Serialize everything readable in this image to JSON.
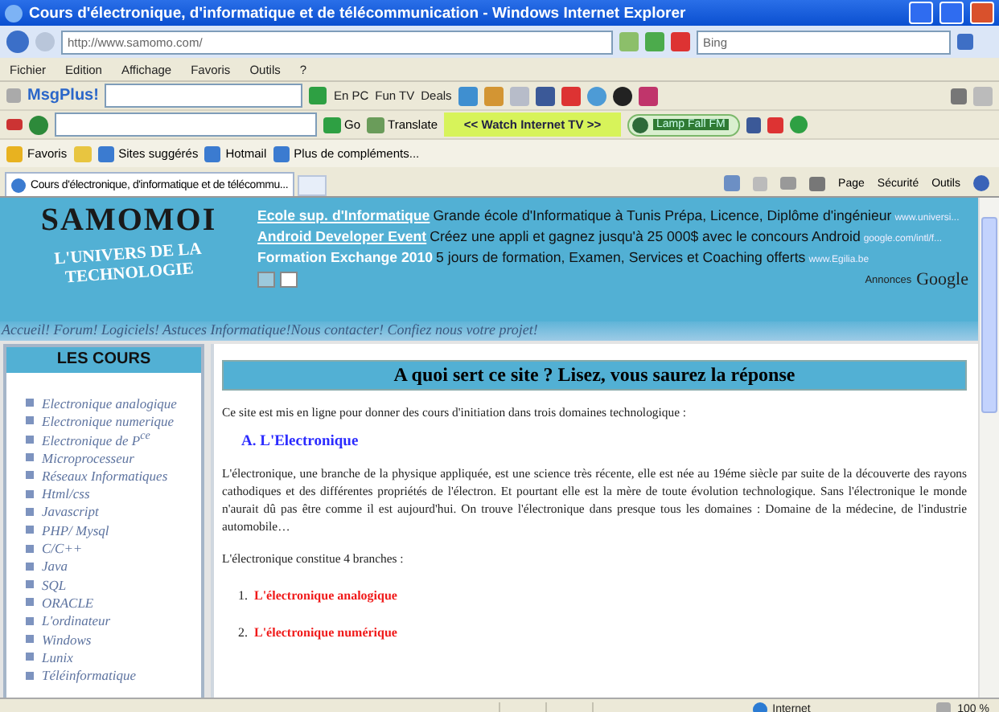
{
  "window": {
    "title": "Cours d'électronique, d'informatique et de télécommunication - Windows Internet Explorer"
  },
  "address_bar": {
    "url": "http://www.samomo.com/",
    "search_placeholder": "Bing"
  },
  "menu": [
    "Fichier",
    "Edition",
    "Affichage",
    "Favoris",
    "Outils",
    "?"
  ],
  "toolbar_msgplus": {
    "brand": "MsgPlus!",
    "items": [
      "En PC",
      "Fun TV",
      "Deals"
    ]
  },
  "toolbar_media": {
    "go": "Go",
    "translate": "Translate",
    "tv": "<< Watch Internet TV >>",
    "radio": "Lamp Fall FM"
  },
  "favorites_bar": {
    "label": "Favoris",
    "items": [
      "Sites suggérés",
      "Hotmail",
      "Plus de compléments..."
    ]
  },
  "tabs": [
    {
      "label": "Cours d'électronique, d'informatique et de télécommu...",
      "selected": true
    }
  ],
  "command_bar": [
    "Page",
    "Sécurité",
    "Outils"
  ],
  "page": {
    "logo": {
      "title": "SAMOMOI",
      "subtitle": "L'UNIVERS DE LA TECHNOLOGIE"
    },
    "ads": [
      {
        "title": "Ecole sup. d'Informatique",
        "text": "Grande école d'Informatique à Tunis Prépa, Licence, Diplôme d'ingénieur",
        "url": "www.universi..."
      },
      {
        "title": "Android Developer Event",
        "text": "Créez une appli et gagnez jusqu'à 25 000$ avec le concours Android",
        "url": "google.com/intl/f..."
      },
      {
        "title": "Formation Exchange 2010",
        "text": "5 jours de formation, Examen, Services et Coaching offerts",
        "url": "www.Egilia.be"
      }
    ],
    "ads_label": "Annonces",
    "ads_brand": "Google",
    "nav_links": "Accueil! Forum! Logiciels! Astuces Informatique!Nous contacter! Confiez nous votre projet!",
    "sidebar": {
      "title": "LES COURS",
      "items": [
        "Electronique analogique",
        "Electronique numerique",
        "Electronique de P$^{ce}$",
        "Microprocesseur",
        "Réseaux Informatiques",
        "Html/css",
        "Javascript",
        "PHP/ Mysql",
        "C/C++",
        "Java",
        "SQL",
        "ORACLE",
        "L'ordinateur",
        "Windows",
        "Lunix",
        "Téléinformatique"
      ]
    },
    "main": {
      "heading": "A quoi sert ce site ? Lisez, vous saurez la réponse",
      "intro": "Ce site est mis en ligne pour donner des cours d'initiation dans trois domaines technologique :",
      "section": "A. L'Electronique",
      "paragraph": "L'électronique, une branche de la physique appliquée, est une science très récente, elle est née au 19éme siècle par suite de la découverte des rayons cathodiques et des différentes propriétés de l'électron. Et pourtant elle est la mère de toute évolution technologique. Sans l'électronique le monde n'aurait dû pas être comme il est aujourd'hui. On trouve l'électronique dans presque tous les domaines : Domaine de la médecine, de l'industrie automobile…",
      "branches_intro": "L'électronique constitue 4 branches :",
      "branches": [
        {
          "number": "1.",
          "label": "L'électronique analogique"
        },
        {
          "number": "2.",
          "label": "L'électronique numérique"
        }
      ]
    }
  },
  "status_bar": {
    "zone": "Internet",
    "zoom": "100 %"
  }
}
